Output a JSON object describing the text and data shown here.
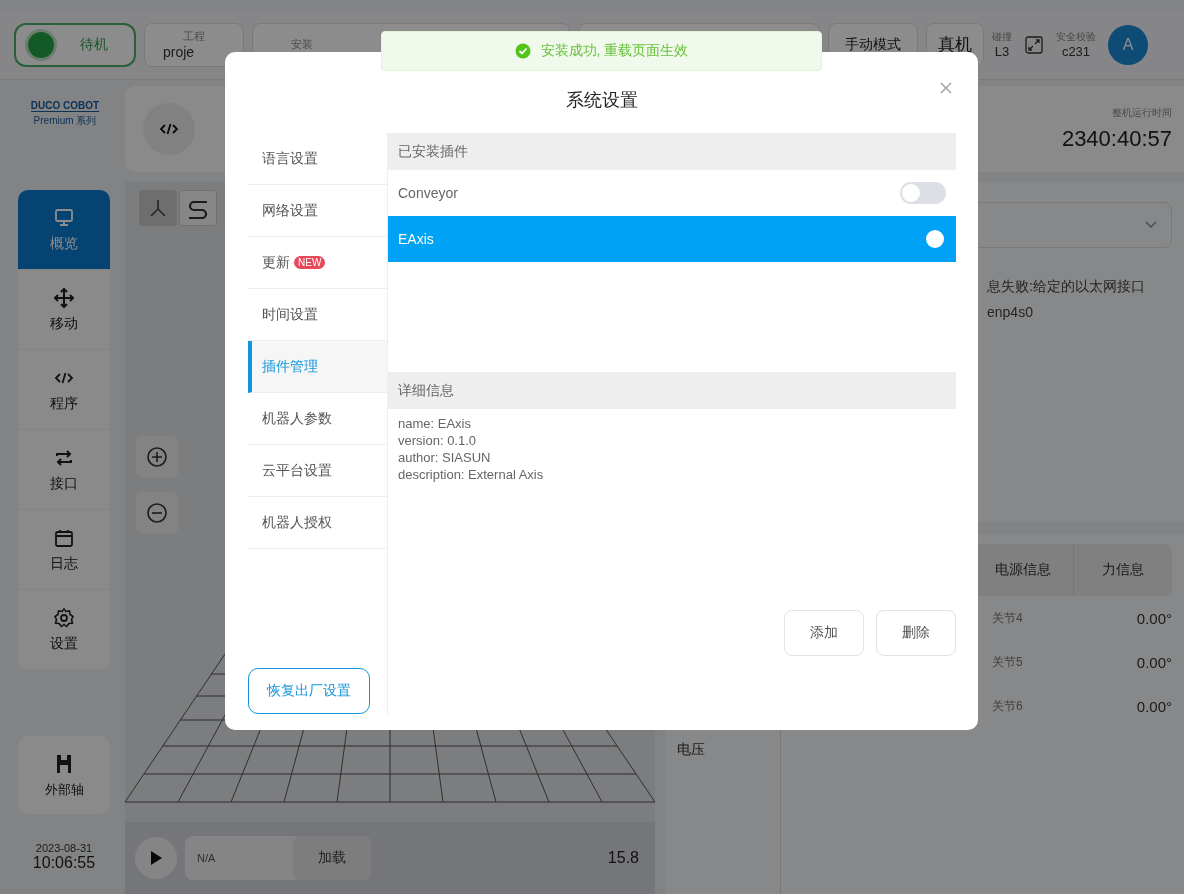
{
  "topbar": {
    "status": "待机",
    "project": {
      "label": "工程",
      "value": "proje"
    },
    "install": {
      "label": "安装"
    },
    "mode": "手动模式",
    "target": "真机",
    "collision": {
      "label": "碰撞",
      "value": "L3"
    },
    "safety": {
      "label": "安全校验",
      "value": "c231"
    },
    "avatar": "A"
  },
  "logo": {
    "brand": "DUCO COBOT",
    "series": "Premium 系列"
  },
  "nav": [
    {
      "label": "概览",
      "selected": true
    },
    {
      "label": "移动",
      "selected": false
    },
    {
      "label": "程序",
      "selected": false
    },
    {
      "label": "接口",
      "selected": false
    },
    {
      "label": "日志",
      "selected": false
    },
    {
      "label": "设置",
      "selected": false
    }
  ],
  "external_axis": "外部轴",
  "clock": {
    "date": "2023-08-31",
    "time": "10:06:55"
  },
  "viewport": {
    "playback_field": "N/A",
    "load_button": "加载",
    "speed": "15.8"
  },
  "right_panel": {
    "runtime_label": "整机运行时间",
    "runtime": "2340:40:57",
    "message": [
      "息失败:给定的以太网接口",
      "enp4s0"
    ],
    "tabs": [
      {
        "label": "电源信息",
        "selected": false
      },
      {
        "label": "力信息",
        "selected": false
      }
    ],
    "voltage_label": "电压",
    "joints": [
      {
        "name": "关节4",
        "value": "0.00°"
      },
      {
        "name": "关节5",
        "value": "0.00°"
      },
      {
        "name": "关节6",
        "value": "0.00°"
      }
    ]
  },
  "dialog": {
    "title": "系统设置",
    "menu": [
      {
        "label": "语言设置",
        "selected": false
      },
      {
        "label": "网络设置",
        "selected": false
      },
      {
        "label": "更新",
        "badge": "NEW",
        "selected": false
      },
      {
        "label": "时间设置",
        "selected": false
      },
      {
        "label": "插件管理",
        "selected": true
      },
      {
        "label": "机器人参数",
        "selected": false
      },
      {
        "label": "云平台设置",
        "selected": false
      },
      {
        "label": "机器人授权",
        "selected": false
      }
    ],
    "reset_button": "恢复出厂设置",
    "installed_header": "已安装插件",
    "plugins": [
      {
        "name": "Conveyor",
        "enabled": false,
        "selected": false
      },
      {
        "name": "EAxis",
        "enabled": true,
        "selected": true
      }
    ],
    "details_header": "详细信息",
    "details": [
      "name: EAxis",
      "version: 0.1.0",
      "author: SIASUN",
      "description: External Axis"
    ],
    "buttons": [
      "添加",
      "删除"
    ]
  },
  "toast": {
    "message": "安装成功, 重载页面生效"
  }
}
